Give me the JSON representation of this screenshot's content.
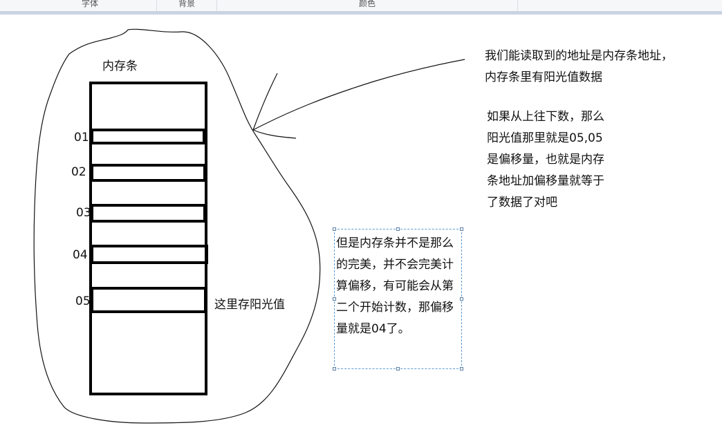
{
  "ribbon": {
    "groups": [
      {
        "label": "字体"
      },
      {
        "label": "背景"
      },
      {
        "label": "颜色"
      }
    ]
  },
  "drawing": {
    "memory_title": "内存条",
    "slot_labels": [
      "01",
      "02",
      "03",
      "04",
      "05"
    ],
    "slot05_note": "这里存阳光值",
    "note_top": [
      "我们能读取到的地址是内存条地址，",
      "内存条里有阳光值数据"
    ],
    "note_middle": [
      "如果从上往下数，那么",
      "阳光值那里就是05,05",
      "是偏移量，也就是内存",
      "条地址加偏移量就等于",
      "了数据了对吧"
    ],
    "selected_textbox": [
      "但是内存条并不是那么",
      "的完美，并不会完美计",
      "算偏移，有可能会从第",
      "二个开始计数，那偏移",
      "量就是04了。"
    ]
  }
}
